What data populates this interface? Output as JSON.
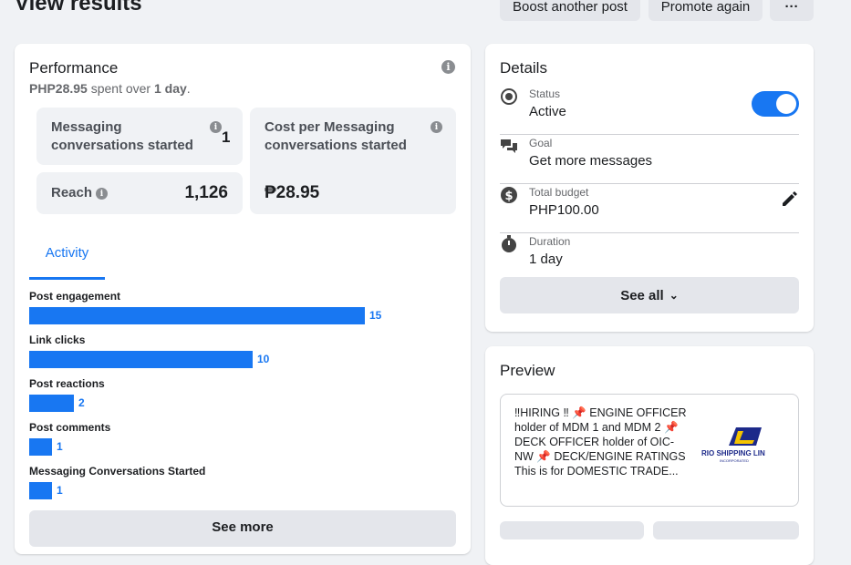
{
  "page_title": "View results",
  "top_buttons": {
    "boost": "Boost another post",
    "promote": "Promote again",
    "more": "···"
  },
  "performance": {
    "title": "Performance",
    "spent": "PHP28.95",
    "spent_mid": " spent over ",
    "duration": "1 day",
    "spent_end": ".",
    "metrics": {
      "messaging_label": "Messaging conversations started",
      "messaging_value": "1",
      "cost_label": "Cost per Messaging conversations started",
      "cost_value": "₱28.95",
      "reach_label": "Reach",
      "reach_value": "1,126"
    },
    "tab": "Activity",
    "see_more": "See more"
  },
  "chart_data": {
    "type": "bar",
    "orientation": "horizontal",
    "categories": [
      "Post engagement",
      "Link clicks",
      "Post reactions",
      "Post comments",
      "Messaging Conversations Started"
    ],
    "values": [
      15,
      10,
      2,
      1,
      1
    ],
    "color": "#1877f2"
  },
  "details": {
    "title": "Details",
    "status_label": "Status",
    "status_value": "Active",
    "status_on": true,
    "goal_label": "Goal",
    "goal_value": "Get more messages",
    "budget_label": "Total budget",
    "budget_value": "PHP100.00",
    "duration_label": "Duration",
    "duration_value": "1 day",
    "see_all": "See all"
  },
  "preview": {
    "title": "Preview",
    "text": "‼HIRING ‼ 📌 ENGINE OFFICER holder of MDM 1 and MDM 2 📌 DECK OFFICER holder of OIC-NW 📌 DECK/ENGINE RATINGS This is for DOMESTIC TRADE...",
    "logo_text": "RIO SHIPPING LIN",
    "logo_sub": "INCORPORATED"
  },
  "colors": {
    "accent": "#1877f2",
    "background": "#f0f2f5"
  }
}
